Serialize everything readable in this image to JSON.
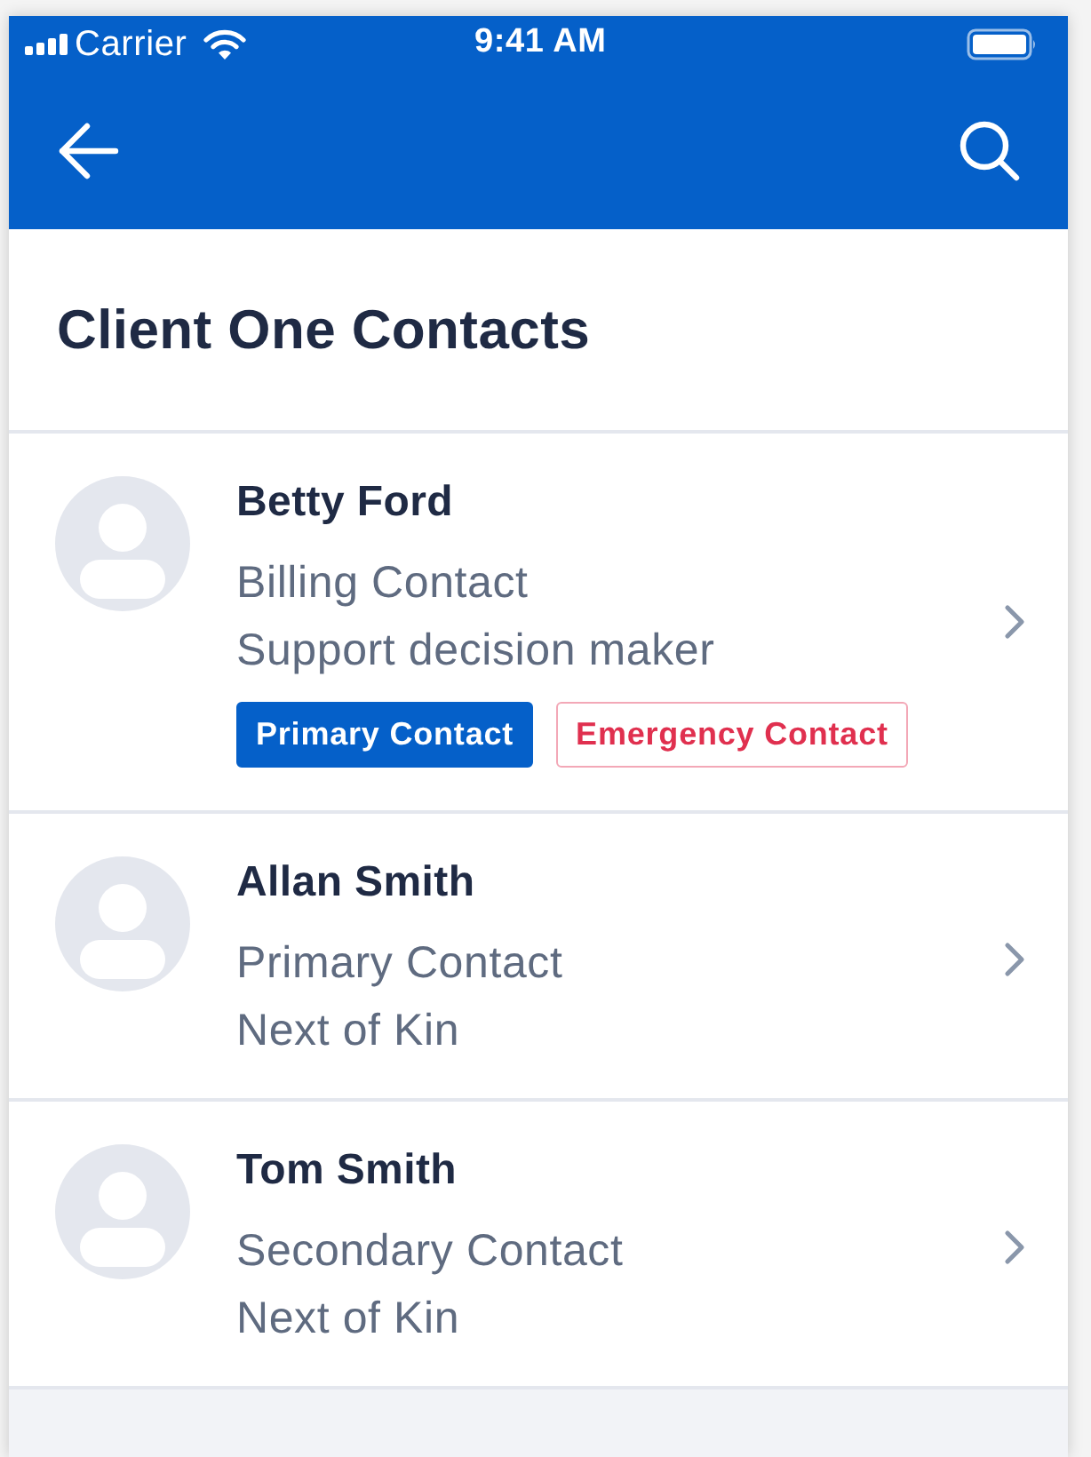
{
  "status_bar": {
    "carrier": "Carrier",
    "time": "9:41 AM"
  },
  "title": "Client One Contacts",
  "contacts": [
    {
      "name": "Betty Ford",
      "details": [
        "Billing Contact",
        "Support decision maker"
      ],
      "tags": [
        {
          "label": "Primary Contact",
          "kind": "filled"
        },
        {
          "label": "Emergency Contact",
          "kind": "outlined"
        }
      ]
    },
    {
      "name": "Allan Smith",
      "details": [
        "Primary Contact",
        "Next of Kin"
      ]
    },
    {
      "name": "Tom Smith",
      "details": [
        "Secondary Contact",
        "Next of Kin"
      ]
    }
  ]
}
